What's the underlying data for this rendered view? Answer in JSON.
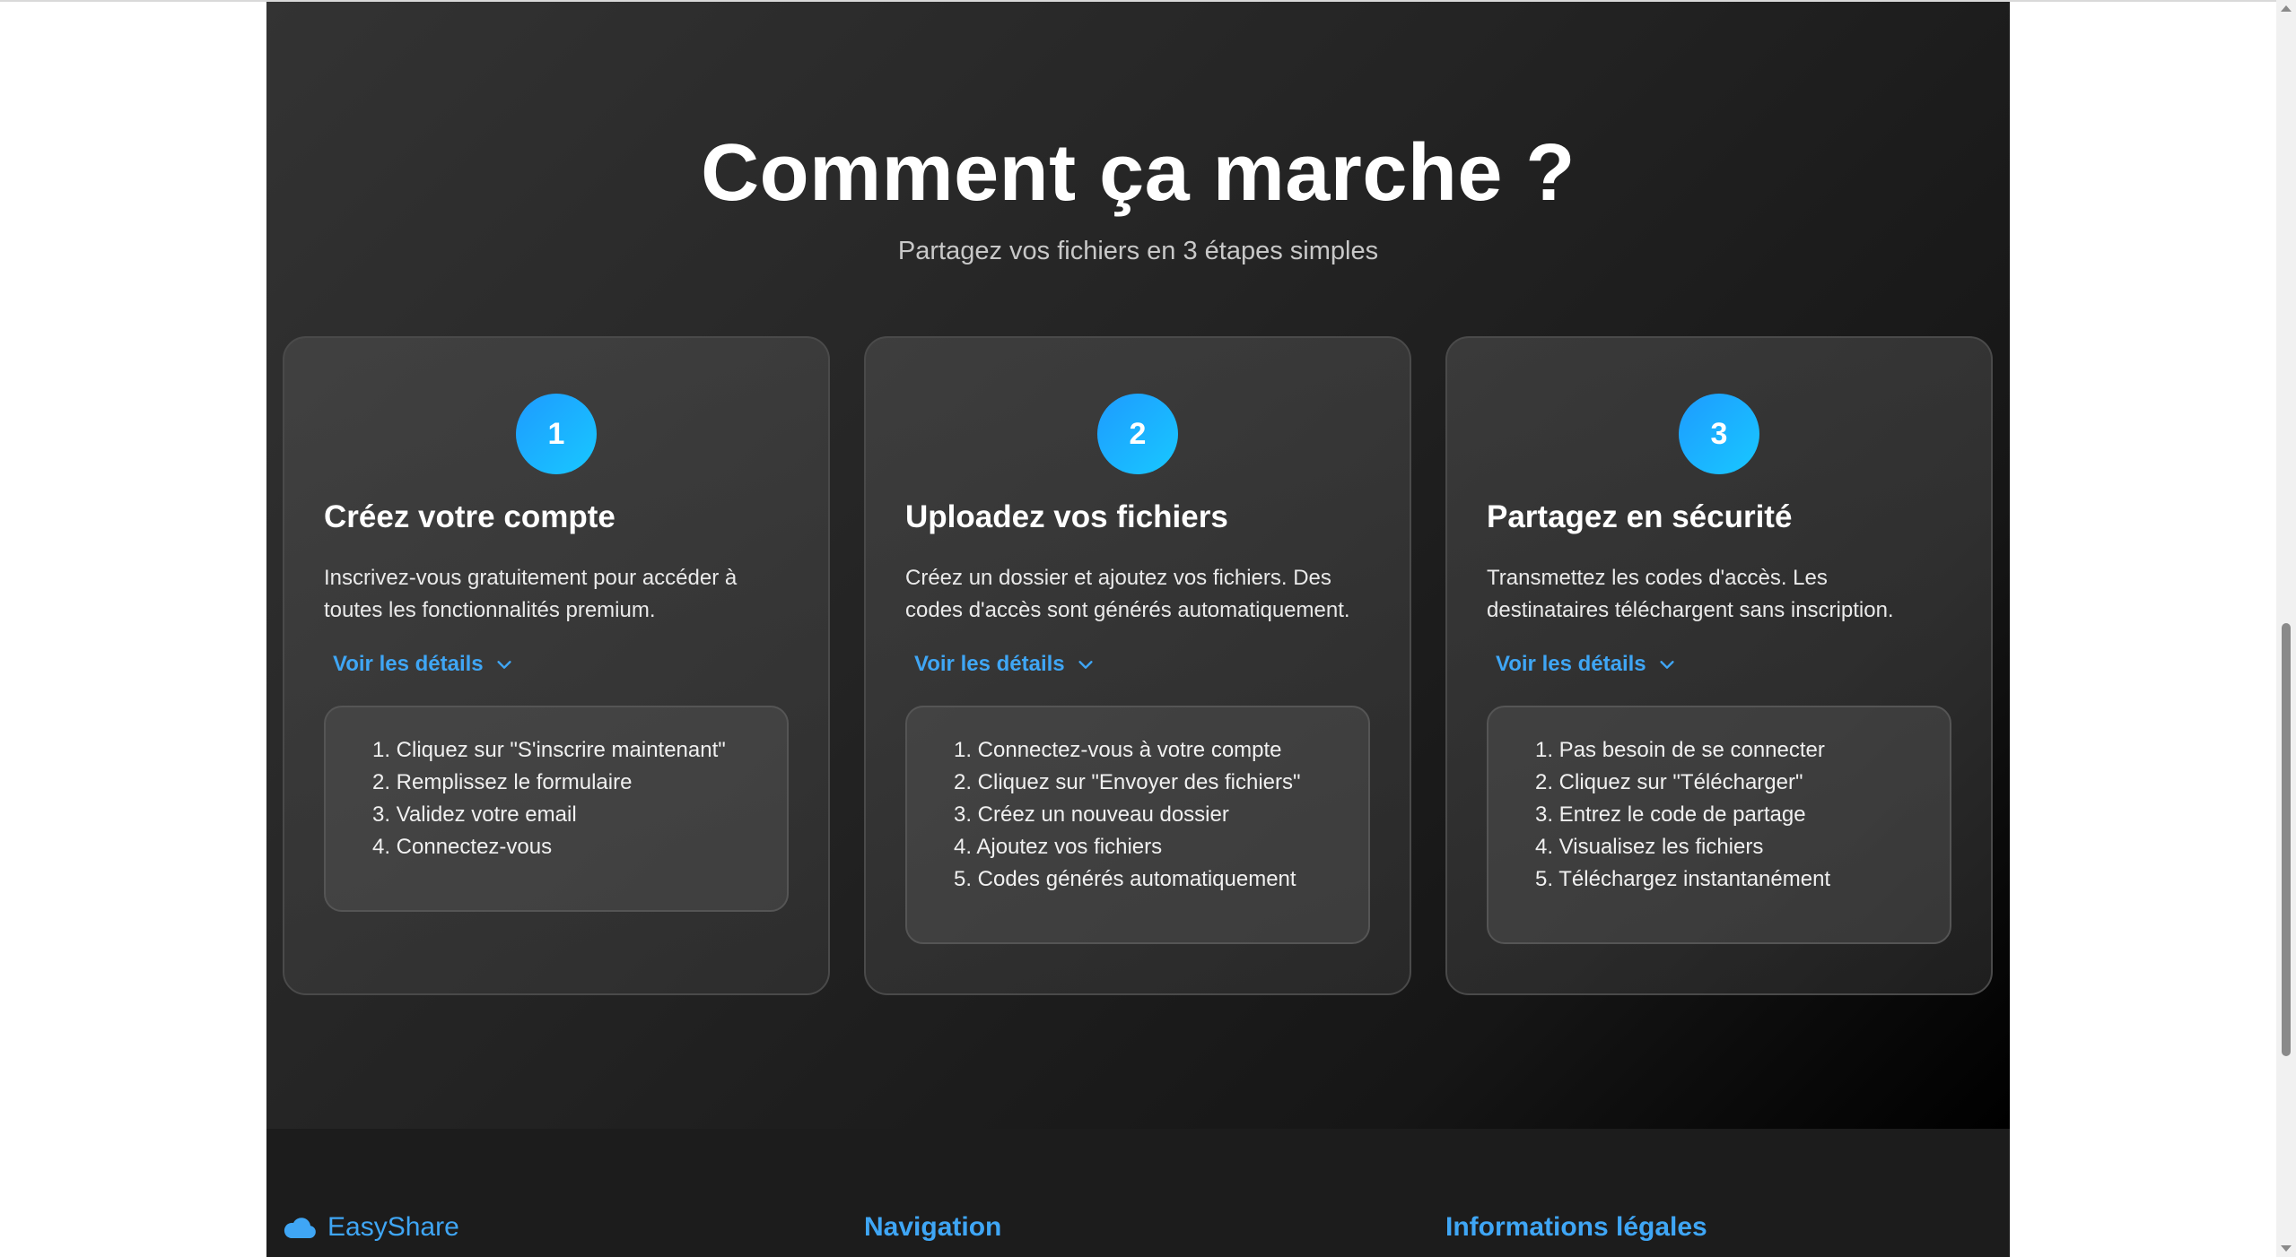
{
  "section": {
    "title": "Comment ça marche ?",
    "subtitle": "Partagez vos fichiers en 3 étapes simples"
  },
  "steps": [
    {
      "number": "1",
      "title": "Créez votre compte",
      "text": "Inscrivez-vous gratuitement pour accéder à toutes les fonctionnalités premium.",
      "toggle_label": "Voir les détails",
      "details": [
        "1. Cliquez sur \"S'inscrire maintenant\"",
        "2. Remplissez le formulaire",
        "3. Validez votre email",
        "4. Connectez-vous"
      ]
    },
    {
      "number": "2",
      "title": "Uploadez vos fichiers",
      "text": "Créez un dossier et ajoutez vos fichiers. Des codes d'accès sont générés automatiquement.",
      "toggle_label": "Voir les détails",
      "details": [
        "1. Connectez-vous à votre compte",
        "2. Cliquez sur \"Envoyer des fichiers\"",
        "3. Créez un nouveau dossier",
        "4. Ajoutez vos fichiers",
        "5. Codes générés automatiquement"
      ]
    },
    {
      "number": "3",
      "title": "Partagez en sécurité",
      "text": "Transmettez les codes d'accès. Les destinataires téléchargent sans inscription.",
      "toggle_label": "Voir les détails",
      "details": [
        "1. Pas besoin de se connecter",
        "2. Cliquez sur \"Télécharger\"",
        "3. Entrez le code de partage",
        "4. Visualisez les fichiers",
        "5. Téléchargez instantanément"
      ]
    }
  ],
  "footer": {
    "brand": "EasyShare",
    "brand_icon": "cloud-icon",
    "nav_heading": "Navigation",
    "legal_heading": "Informations légales"
  },
  "colors": {
    "accent": "#3fa6f5",
    "badge_start": "#1e9bff",
    "badge_end": "#18c8ff",
    "section_bg_dark": "#000000",
    "footer_bg": "#1c1c1c"
  }
}
